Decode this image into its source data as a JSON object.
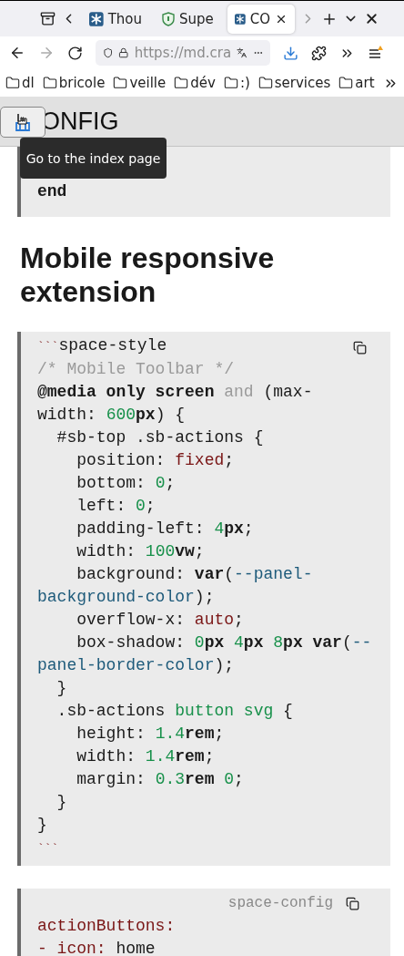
{
  "browser": {
    "tabs": [
      {
        "title": "Thou",
        "kind": "snowflake",
        "selected": false
      },
      {
        "title": "Supe",
        "kind": "shield",
        "selected": false
      },
      {
        "title": "CO",
        "kind": "snowflake",
        "selected": true
      }
    ],
    "back_disabled": false,
    "forward_disabled": true,
    "url": "https://md.cra",
    "bookmarks": [
      "dl",
      "bricole",
      "veille",
      "dév",
      ":)",
      "services",
      "art"
    ]
  },
  "page": {
    "title": "ONFIG",
    "tooltip": "Go to the index page",
    "blocks": [
      {
        "kind": "code",
        "copy_button": false,
        "lines": [
          [
            {
              "kind": "bold",
              "text": "end"
            }
          ]
        ]
      },
      {
        "kind": "heading",
        "text": "Mobile responsive extension"
      },
      {
        "kind": "code",
        "copy_button": true,
        "lines": [
          [
            {
              "kind": "fence",
              "text": "```"
            },
            {
              "kind": "plain",
              "text": "space-style"
            }
          ],
          [
            {
              "kind": "comment",
              "text": "/* Mobile Toolbar */"
            }
          ],
          [
            {
              "kind": "bold",
              "text": "@media only screen"
            },
            {
              "kind": "comment",
              "text": " and "
            },
            {
              "kind": "plain",
              "text": "(max-"
            }
          ],
          [
            {
              "kind": "plain",
              "text": "width: "
            },
            {
              "kind": "number",
              "text": "600"
            },
            {
              "kind": "bold",
              "text": "px"
            },
            {
              "kind": "plain",
              "text": ") {"
            }
          ],
          [
            {
              "kind": "plain",
              "text": "  #sb-top .sb-actions {"
            }
          ],
          [
            {
              "kind": "plain",
              "text": "    position: "
            },
            {
              "kind": "value",
              "text": "fixed"
            },
            {
              "kind": "plain",
              "text": ";"
            }
          ],
          [
            {
              "kind": "plain",
              "text": "    bottom: "
            },
            {
              "kind": "number",
              "text": "0"
            },
            {
              "kind": "plain",
              "text": ";"
            }
          ],
          [
            {
              "kind": "plain",
              "text": "    left: "
            },
            {
              "kind": "number",
              "text": "0"
            },
            {
              "kind": "plain",
              "text": ";"
            }
          ],
          [
            {
              "kind": "plain",
              "text": "    padding-left: "
            },
            {
              "kind": "number",
              "text": "4"
            },
            {
              "kind": "bold",
              "text": "px"
            },
            {
              "kind": "plain",
              "text": ";"
            }
          ],
          [
            {
              "kind": "plain",
              "text": "    width: "
            },
            {
              "kind": "number",
              "text": "100"
            },
            {
              "kind": "bold",
              "text": "vw"
            },
            {
              "kind": "plain",
              "text": ";"
            }
          ],
          [
            {
              "kind": "plain",
              "text": "    background: "
            },
            {
              "kind": "bold",
              "text": "var"
            },
            {
              "kind": "plain",
              "text": "("
            },
            {
              "kind": "variable",
              "text": "--panel-"
            }
          ],
          [
            {
              "kind": "variable",
              "text": "background-color"
            },
            {
              "kind": "plain",
              "text": ");"
            }
          ],
          [
            {
              "kind": "plain",
              "text": "    overflow-x: "
            },
            {
              "kind": "value",
              "text": "auto"
            },
            {
              "kind": "plain",
              "text": ";"
            }
          ],
          [
            {
              "kind": "plain",
              "text": "    box-shadow: "
            },
            {
              "kind": "number",
              "text": "0"
            },
            {
              "kind": "bold",
              "text": "px "
            },
            {
              "kind": "number",
              "text": "4"
            },
            {
              "kind": "bold",
              "text": "px "
            },
            {
              "kind": "number",
              "text": "8"
            },
            {
              "kind": "bold",
              "text": "px var"
            },
            {
              "kind": "plain",
              "text": "("
            },
            {
              "kind": "variable",
              "text": "--"
            }
          ],
          [
            {
              "kind": "variable",
              "text": "panel-border-color"
            },
            {
              "kind": "plain",
              "text": ");"
            }
          ],
          [
            {
              "kind": "plain",
              "text": "  }"
            }
          ],
          [
            {
              "kind": "plain",
              "text": "  .sb-actions "
            },
            {
              "kind": "selector",
              "text": "button svg"
            },
            {
              "kind": "plain",
              "text": " {"
            }
          ],
          [
            {
              "kind": "plain",
              "text": "    height: "
            },
            {
              "kind": "number",
              "text": "1.4"
            },
            {
              "kind": "bold",
              "text": "rem"
            },
            {
              "kind": "plain",
              "text": ";"
            }
          ],
          [
            {
              "kind": "plain",
              "text": "    width: "
            },
            {
              "kind": "number",
              "text": "1.4"
            },
            {
              "kind": "bold",
              "text": "rem"
            },
            {
              "kind": "plain",
              "text": ";"
            }
          ],
          [
            {
              "kind": "plain",
              "text": "    margin: "
            },
            {
              "kind": "number",
              "text": "0.3"
            },
            {
              "kind": "bold",
              "text": "rem "
            },
            {
              "kind": "number",
              "text": "0"
            },
            {
              "kind": "plain",
              "text": ";"
            }
          ],
          [
            {
              "kind": "plain",
              "text": "  }"
            }
          ],
          [
            {
              "kind": "plain",
              "text": "}"
            }
          ],
          [
            {
              "kind": "fence",
              "text": "```"
            }
          ]
        ]
      },
      {
        "kind": "code",
        "copy_button": true,
        "label": "space-config",
        "lines": [
          [
            {
              "kind": "value",
              "text": "actionButtons:"
            }
          ],
          [
            {
              "kind": "value",
              "text": "- icon: "
            },
            {
              "kind": "plain",
              "text": "home"
            }
          ]
        ]
      }
    ]
  }
}
